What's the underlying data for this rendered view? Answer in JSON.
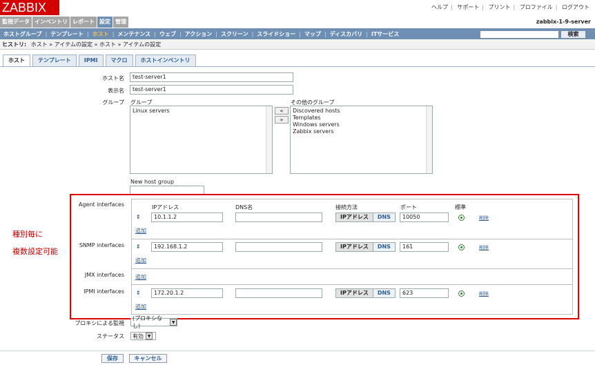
{
  "logo": "ZABBIX",
  "top_links": [
    "ヘルプ",
    "サポート",
    "プリント",
    "プロファイル",
    "ログアウト"
  ],
  "main_menu": [
    {
      "label": "監視データ",
      "active": false
    },
    {
      "label": "インベントリ",
      "active": false
    },
    {
      "label": "レポート",
      "active": false
    },
    {
      "label": "設定",
      "active": true
    },
    {
      "label": "管理",
      "active": false
    }
  ],
  "server_name": "zabbix-1-9-server",
  "sub_menu": [
    {
      "label": "ホストグループ",
      "active": false
    },
    {
      "label": "テンプレート",
      "active": false
    },
    {
      "label": "ホスト",
      "active": true
    },
    {
      "label": "メンテナンス",
      "active": false
    },
    {
      "label": "ウェブ",
      "active": false
    },
    {
      "label": "アクション",
      "active": false
    },
    {
      "label": "スクリーン",
      "active": false
    },
    {
      "label": "スライドショー",
      "active": false
    },
    {
      "label": "マップ",
      "active": false
    },
    {
      "label": "ディスカバリ",
      "active": false
    },
    {
      "label": "ITサービス",
      "active": false
    }
  ],
  "search": {
    "value": "",
    "button": "検索"
  },
  "history": {
    "label": "ヒストリ:",
    "items": [
      "ホスト",
      "アイテムの設定",
      "ホスト",
      "アイテムの設定"
    ],
    "separator": "»"
  },
  "tabs": [
    {
      "label": "ホスト",
      "active": true
    },
    {
      "label": "テンプレート",
      "active": false
    },
    {
      "label": "IPMI",
      "active": false
    },
    {
      "label": "マクロ",
      "active": false
    },
    {
      "label": "ホストインベントリ",
      "active": false
    }
  ],
  "form": {
    "host_name_label": "ホスト名",
    "host_name": "test-server1",
    "display_name_label": "表示名",
    "display_name": "test-server1",
    "groups_label": "グループ",
    "groups_header": "グループ",
    "groups": [
      "Linux servers"
    ],
    "other_groups_header": "その他のグループ",
    "other_groups": [
      "Discovered hosts",
      "Templates",
      "Windows servers",
      "Zabbix servers"
    ],
    "move_left": "«",
    "move_right": "»",
    "new_group_label": "New host group",
    "new_group_value": ""
  },
  "interfaces": {
    "columns": {
      "ip": "IPアドレス",
      "dns": "DNS名",
      "connect": "接続方法",
      "port": "ポート",
      "default": "標準"
    },
    "ip_button": "IPアドレス",
    "dns_button": "DNS",
    "add_label": "追加",
    "delete_label": "削除",
    "agent": {
      "label": "Agent interfaces",
      "ip": "10.1.1.2",
      "dns": "",
      "port": "10050"
    },
    "snmp": {
      "label": "SNMP interfaces",
      "ip": "192.168.1.2",
      "dns": "",
      "port": "161"
    },
    "jmx": {
      "label": "JMX interfaces"
    },
    "ipmi": {
      "label": "IPMI interfaces",
      "ip": "172.20.1.2",
      "dns": "",
      "port": "623"
    }
  },
  "annotation": {
    "line1": "種別毎に",
    "line2": "複数設定可能",
    "color": "#c00000"
  },
  "proxy": {
    "label": "プロキシによる監視",
    "value": "(プロキシなし)"
  },
  "status": {
    "label": "ステータス",
    "value": "有効"
  },
  "buttons": {
    "save": "保存",
    "cancel": "キャンセル"
  },
  "colors": {
    "brand": "#d40000",
    "menu_active": "#6e8fb3",
    "highlight_box": "#e00000"
  }
}
